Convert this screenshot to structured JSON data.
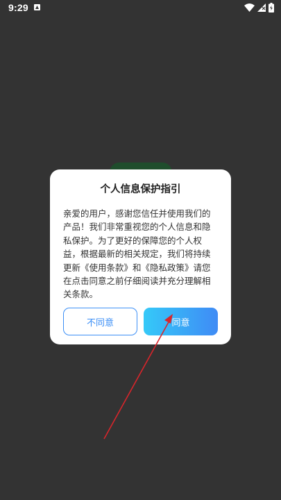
{
  "status_bar": {
    "time": "9:29",
    "icons": [
      "notification-icon",
      "wifi-icon",
      "cellular-signal-icon",
      "battery-icon"
    ]
  },
  "dialog": {
    "title": "个人信息保护指引",
    "body": "亲爱的用户，感谢您信任并使用我们的产品！我们非常重视您的个人信息和隐私保护。为了更好的保障您的个人权益，根据最新的相关规定，我们将持续更新《使用条款》和《隐私政策》请您在点击同意之前仔细阅读并充分理解相关条款。",
    "decline_label": "不同意",
    "accept_label": "同意"
  },
  "colors": {
    "overlay": "#333333",
    "accent": "#3a8ef6",
    "annotation_arrow": "#d9252b"
  }
}
